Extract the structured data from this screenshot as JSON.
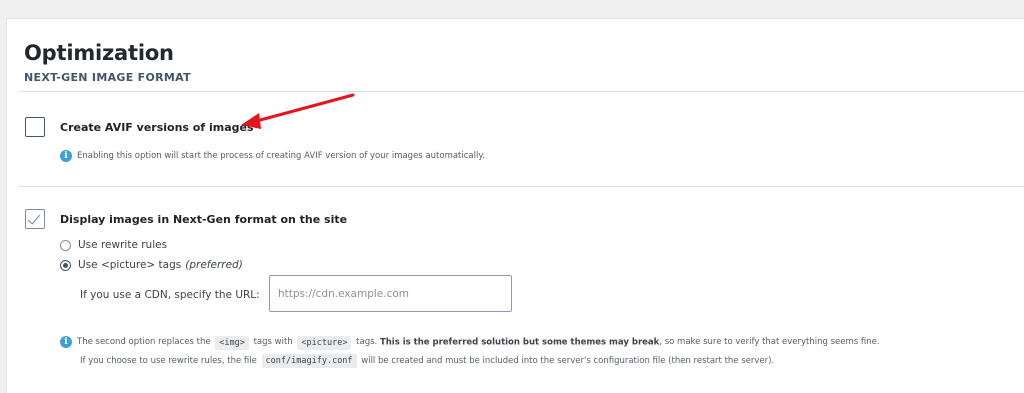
{
  "section": {
    "title": "Optimization",
    "subtitle": "NEXT-GEN IMAGE FORMAT"
  },
  "avif": {
    "label": "Create AVIF versions of images",
    "checked": false,
    "help": "Enabling this option will start the process of creating AVIF version of your images automatically."
  },
  "display": {
    "label": "Display images in Next-Gen format on the site",
    "checked": true,
    "radio_options": [
      {
        "label": "Use rewrite rules",
        "note": "",
        "selected": false
      },
      {
        "label": "Use <picture> tags",
        "note": "(preferred)",
        "selected": true
      }
    ],
    "cdn": {
      "label": "If you use a CDN, specify the URL:",
      "value": "",
      "placeholder": "https://cdn.example.com"
    },
    "help": {
      "line1_a": "The second option replaces the",
      "code_img": "<img>",
      "line1_b": "tags with",
      "code_picture": "<picture>",
      "line1_c": "tags.",
      "line1_strong": "This is the preferred solution but some themes may break",
      "line1_d": ", so make sure to verify that everything seems fine.",
      "line2_a": "If you choose to use rewrite rules, the file",
      "code_conf": "conf/imagify.conf",
      "line2_b": "will be created and must be included into the server's configuration file (then restart the server)."
    }
  },
  "info_icon_glyph": "i",
  "colors": {
    "accent": "#40576b",
    "info": "#3ba0d6",
    "annotation_arrow": "#e8141b"
  }
}
